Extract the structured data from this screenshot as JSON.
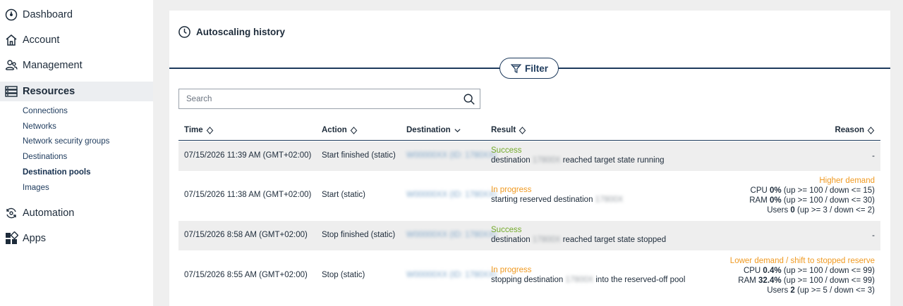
{
  "sidebar": {
    "items": [
      {
        "label": "Dashboard",
        "icon": "dashboard-icon"
      },
      {
        "label": "Account",
        "icon": "home-icon"
      },
      {
        "label": "Management",
        "icon": "users-icon"
      },
      {
        "label": "Resources",
        "icon": "server-icon",
        "active": true
      },
      {
        "label": "Automation",
        "icon": "automation-icon"
      },
      {
        "label": "Apps",
        "icon": "apps-icon"
      }
    ],
    "resources_sub": [
      {
        "label": "Connections"
      },
      {
        "label": "Networks"
      },
      {
        "label": "Network security groups"
      },
      {
        "label": "Destinations"
      },
      {
        "label": "Destination pools",
        "active": true
      },
      {
        "label": "Images"
      }
    ]
  },
  "panel": {
    "title": "Autoscaling history",
    "filter_label": "Filter",
    "search_placeholder": "Search"
  },
  "table": {
    "columns": {
      "time": "Time",
      "action": "Action",
      "destination": "Destination",
      "result": "Result",
      "reason": "Reason"
    },
    "rows": [
      {
        "time": "07/15/2026 11:39 AM (GMT+02:00)",
        "action": "Start finished (static)",
        "destination": "W00000XX (ID: 1780XX)",
        "result_status": "Success",
        "result_prefix": "destination",
        "result_blur": "17800X",
        "result_suffix": "reached target state running",
        "reason_dash": "-"
      },
      {
        "time": "07/15/2026 11:38 AM (GMT+02:00)",
        "action": "Start (static)",
        "destination": "W00000XX (ID: 1780XX)",
        "result_status": "In progress",
        "result_prefix": "starting reserved destination",
        "result_blur": "17800X",
        "result_suffix": "",
        "reason_title": "Higher demand",
        "reason_cpu_label": "CPU",
        "reason_cpu_value": "0%",
        "reason_cpu_rule": "(up >= 100 / down <= 15)",
        "reason_ram_label": "RAM",
        "reason_ram_value": "0%",
        "reason_ram_rule": "(up >= 100 / down <= 30)",
        "reason_users_label": "Users",
        "reason_users_value": "0",
        "reason_users_rule": "(up >= 3 / down <= 2)"
      },
      {
        "time": "07/15/2026 8:58 AM (GMT+02:00)",
        "action": "Stop finished (static)",
        "destination": "W00000XX (ID: 1780XX)",
        "result_status": "Success",
        "result_prefix": "destination",
        "result_blur": "17800X",
        "result_suffix": "reached target state stopped",
        "reason_dash": "-"
      },
      {
        "time": "07/15/2026 8:55 AM (GMT+02:00)",
        "action": "Stop (static)",
        "destination": "W00000XX (ID: 1780XX)",
        "result_status": "In progress",
        "result_prefix": "stopping destination",
        "result_blur": "17800X",
        "result_suffix": "into the reserved-off pool",
        "reason_title": "Lower demand / shift to stopped reserve",
        "reason_cpu_label": "CPU",
        "reason_cpu_value": "0.4%",
        "reason_cpu_rule": "(up >= 100 / down <= 99)",
        "reason_ram_label": "RAM",
        "reason_ram_value": "32.4%",
        "reason_ram_rule": "(up >= 100 / down <= 99)",
        "reason_users_label": "Users",
        "reason_users_value": "2",
        "reason_users_rule": "(up >= 5 / down <= 3)"
      }
    ]
  },
  "colors": {
    "success": "#73a92a",
    "in_progress": "#f09a22",
    "navy": "#1d3a5c"
  }
}
